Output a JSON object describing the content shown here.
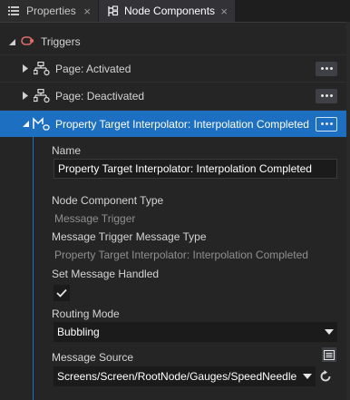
{
  "tabs": [
    {
      "label": "Properties",
      "icon": "list-icon",
      "active": false
    },
    {
      "label": "Node Components",
      "icon": "node-components-icon",
      "active": true
    }
  ],
  "close_glyph": "×",
  "tree": {
    "header": {
      "label": "Triggers",
      "icon": "trigger-icon",
      "expanded": true
    },
    "items": [
      {
        "label": "Page: Activated",
        "icon": "page-trigger-icon",
        "expanded": false,
        "selected": false
      },
      {
        "label": "Page: Deactivated",
        "icon": "page-trigger-icon",
        "expanded": false,
        "selected": false
      },
      {
        "label": "Property Target Interpolator: Interpolation Completed",
        "icon": "message-trigger-icon",
        "expanded": true,
        "selected": true
      }
    ]
  },
  "properties": {
    "name_label": "Name",
    "name_value": "Property Target Interpolator: Interpolation Completed",
    "component_type_label": "Node Component Type",
    "component_type_value": "Message Trigger",
    "message_type_label": "Message Trigger Message Type",
    "message_type_value": "Property Target Interpolator: Interpolation Completed",
    "handled_label": "Set Message Handled",
    "handled_checked": true,
    "routing_label": "Routing Mode",
    "routing_value": "Bubbling",
    "source_label": "Message Source",
    "source_value": "Screens/Screen/RootNode/Gauges/SpeedNeedle"
  },
  "colors": {
    "selection": "#1d6fc2",
    "background": "#252526",
    "input_background": "#1b1b1c",
    "trigger_icon": "#e06a6a"
  }
}
